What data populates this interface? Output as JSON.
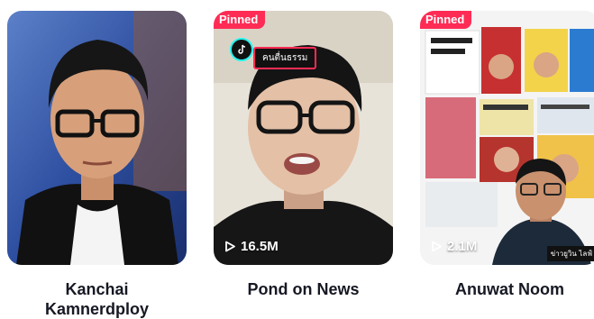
{
  "creators": [
    {
      "name_lines": [
        "Kanchai",
        "Kamnerdploy"
      ],
      "pinned": false,
      "views": ""
    },
    {
      "name_lines": [
        "Pond on News"
      ],
      "pinned": true,
      "pinned_label": "Pinned",
      "views": "16.5M",
      "sticker_text": "คนตื่นธรรม"
    },
    {
      "name_lines": [
        "Anuwat Noom"
      ],
      "pinned": true,
      "pinned_label": "Pinned",
      "views": "2.1M",
      "corner_caption": "ข่าวยูวิน ไลฟ์"
    }
  ],
  "colors": {
    "pinned_bg": "#fe2c55",
    "name_text": "#161823",
    "tiktok_cyan": "#25f4ee"
  },
  "icons": {
    "views": "play-outline-icon",
    "app": "tiktok-logo-icon"
  }
}
